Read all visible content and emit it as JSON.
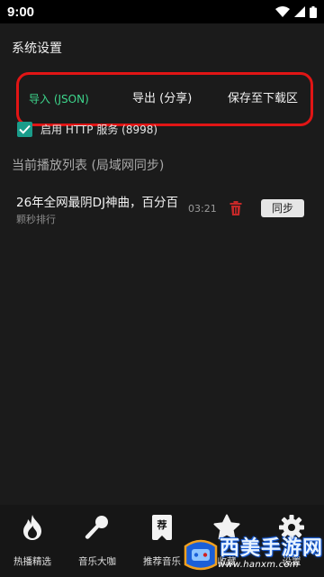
{
  "status_bar": {
    "time": "9:00"
  },
  "settings": {
    "title": "系统设置",
    "import_label": "导入 (JSON)",
    "export_label": "导出 (分享)",
    "save_label": "保存至下载区",
    "http_label": "启用 HTTP 服务 (8998)",
    "http_enabled": true
  },
  "playlist": {
    "header": "当前播放列表 (局域网同步)",
    "items": [
      {
        "title": "26年全网最阴DJ神曲，百分百",
        "subtitle": "颗秒排行",
        "duration": "03:21",
        "sync_label": "同步"
      }
    ]
  },
  "bottom_nav": {
    "items": [
      {
        "label": "热播精选",
        "icon": "fire-icon"
      },
      {
        "label": "音乐大咖",
        "icon": "microphone-icon"
      },
      {
        "label": "推荐音乐",
        "icon": "recommend-badge-icon",
        "badge_text": "荐"
      },
      {
        "label": "收藏",
        "icon": "star-icon"
      },
      {
        "label": "设置",
        "icon": "gear-icon"
      }
    ]
  },
  "watermark": {
    "text": "西美手游网",
    "url": "www.hanxm.com"
  },
  "colors": {
    "accent_green": "#3dd68c",
    "checkbox_teal": "#1a9c8a",
    "highlight_red": "#e11515",
    "trash_red": "#c62828",
    "background": "#1b1b1b"
  }
}
